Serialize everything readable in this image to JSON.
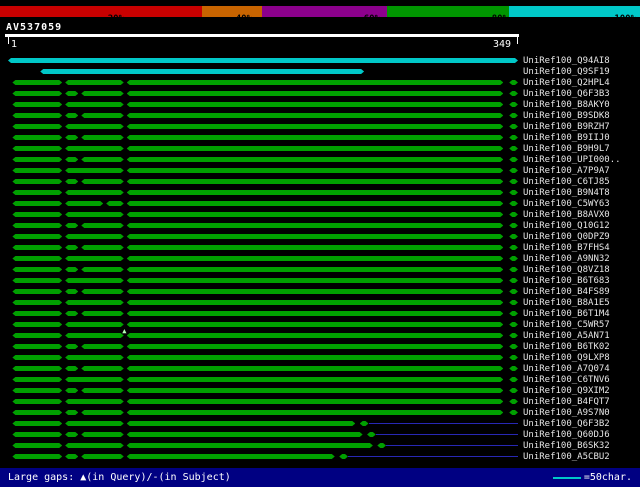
{
  "scale_bar": {
    "labels": [
      "20%",
      "~40%",
      "~60%",
      "~80%",
      "~100%"
    ],
    "segments": [
      {
        "color": "#c80000",
        "width_pct": 31.5
      },
      {
        "color": "#c86400",
        "width_pct": 9.5
      },
      {
        "color": "#8c008c",
        "width_pct": 19.5
      },
      {
        "color": "#009600",
        "width_pct": 19.0
      },
      {
        "color": "#00c8c8",
        "width_pct": 20.5
      }
    ]
  },
  "query": {
    "name": "AV537059",
    "start": "1",
    "end": "349"
  },
  "legend": {
    "gaps_text": "Large gaps: ▲(in Query)/-(in Subject)",
    "unit_text": "=50char."
  },
  "colors": {
    "hit_green": "#00a000",
    "hit_cyan": "#00c8c8",
    "tail_blue": "#2828b4",
    "legend_bg": "#000082",
    "marker_green": "#b4ffb4"
  },
  "chart_data": {
    "type": "bar",
    "orientation": "horizontal",
    "title": "AV537059",
    "axis": {
      "min": 1,
      "max": 349,
      "start_label": "1",
      "end_label": "349"
    },
    "identity_scale_labels": [
      "20%",
      "~40%",
      "~60%",
      "~80%",
      "~100%"
    ],
    "rows": [
      {
        "label": "UniRef100_Q94AI8",
        "color": "cyan",
        "segments": [
          [
            1,
            349
          ]
        ]
      },
      {
        "label": "UniRef100_Q9SF19",
        "color": "cyan",
        "segments": [
          [
            23,
            244
          ]
        ]
      },
      {
        "label": "UniRef100_Q2HPL4",
        "color": "green",
        "segments": [
          [
            4,
            38
          ],
          [
            40,
            80
          ],
          [
            82,
            339
          ],
          [
            343,
            349
          ]
        ]
      },
      {
        "label": "UniRef100_Q6F3B3",
        "color": "green",
        "segments": [
          [
            4,
            38
          ],
          [
            40,
            49
          ],
          [
            51,
            80
          ],
          [
            82,
            339
          ],
          [
            343,
            349
          ]
        ]
      },
      {
        "label": "UniRef100_B8AKY0",
        "color": "green",
        "segments": [
          [
            4,
            38
          ],
          [
            40,
            80
          ],
          [
            82,
            339
          ],
          [
            343,
            349
          ]
        ]
      },
      {
        "label": "UniRef100_B9SDK8",
        "color": "green",
        "segments": [
          [
            4,
            38
          ],
          [
            40,
            49
          ],
          [
            51,
            80
          ],
          [
            82,
            339
          ],
          [
            343,
            349
          ]
        ]
      },
      {
        "label": "UniRef100_B9RZH7",
        "color": "green",
        "segments": [
          [
            4,
            38
          ],
          [
            40,
            80
          ],
          [
            82,
            339
          ],
          [
            343,
            349
          ]
        ]
      },
      {
        "label": "UniRef100_B9IIJ0",
        "color": "green",
        "segments": [
          [
            4,
            38
          ],
          [
            40,
            49
          ],
          [
            51,
            80
          ],
          [
            82,
            339
          ],
          [
            343,
            349
          ]
        ]
      },
      {
        "label": "UniRef100_B9H9L7",
        "color": "green",
        "segments": [
          [
            4,
            38
          ],
          [
            40,
            80
          ],
          [
            82,
            339
          ],
          [
            343,
            349
          ]
        ]
      },
      {
        "label": "UniRef100_UPI000..",
        "color": "green",
        "segments": [
          [
            4,
            38
          ],
          [
            40,
            49
          ],
          [
            51,
            80
          ],
          [
            82,
            339
          ],
          [
            343,
            349
          ]
        ]
      },
      {
        "label": "UniRef100_A7P9A7",
        "color": "green",
        "segments": [
          [
            4,
            38
          ],
          [
            40,
            80
          ],
          [
            82,
            339
          ],
          [
            343,
            349
          ]
        ]
      },
      {
        "label": "UniRef100_C6TJ85",
        "color": "green",
        "segments": [
          [
            4,
            38
          ],
          [
            40,
            49
          ],
          [
            51,
            80
          ],
          [
            82,
            339
          ],
          [
            343,
            349
          ]
        ]
      },
      {
        "label": "UniRef100_B9N4T8",
        "color": "green",
        "segments": [
          [
            4,
            38
          ],
          [
            40,
            80
          ],
          [
            82,
            339
          ],
          [
            343,
            349
          ]
        ]
      },
      {
        "label": "UniRef100_C5WY63",
        "color": "green",
        "segments": [
          [
            4,
            38
          ],
          [
            40,
            66
          ],
          [
            68,
            80
          ],
          [
            82,
            339
          ],
          [
            343,
            349
          ]
        ]
      },
      {
        "label": "UniRef100_B8AVX0",
        "color": "green",
        "segments": [
          [
            4,
            38
          ],
          [
            40,
            80
          ],
          [
            82,
            339
          ],
          [
            343,
            349
          ]
        ]
      },
      {
        "label": "UniRef100_Q10G12",
        "color": "green",
        "segments": [
          [
            4,
            38
          ],
          [
            40,
            49
          ],
          [
            51,
            80
          ],
          [
            82,
            339
          ],
          [
            343,
            349
          ]
        ]
      },
      {
        "label": "UniRef100_Q0DPZ9",
        "color": "green",
        "segments": [
          [
            4,
            38
          ],
          [
            40,
            80
          ],
          [
            82,
            339
          ],
          [
            343,
            349
          ]
        ]
      },
      {
        "label": "UniRef100_B7FHS4",
        "color": "green",
        "segments": [
          [
            4,
            38
          ],
          [
            40,
            49
          ],
          [
            51,
            80
          ],
          [
            82,
            339
          ],
          [
            343,
            349
          ]
        ]
      },
      {
        "label": "UniRef100_A9NN32",
        "color": "green",
        "segments": [
          [
            4,
            38
          ],
          [
            40,
            80
          ],
          [
            82,
            339
          ],
          [
            343,
            349
          ]
        ]
      },
      {
        "label": "UniRef100_Q8VZ18",
        "color": "green",
        "segments": [
          [
            4,
            38
          ],
          [
            40,
            49
          ],
          [
            51,
            80
          ],
          [
            82,
            339
          ],
          [
            343,
            349
          ]
        ]
      },
      {
        "label": "UniRef100_B6T683",
        "color": "green",
        "segments": [
          [
            4,
            38
          ],
          [
            40,
            80
          ],
          [
            82,
            339
          ],
          [
            343,
            349
          ]
        ]
      },
      {
        "label": "UniRef100_B4FS89",
        "color": "green",
        "segments": [
          [
            4,
            38
          ],
          [
            40,
            49
          ],
          [
            51,
            80
          ],
          [
            82,
            339
          ],
          [
            343,
            349
          ]
        ]
      },
      {
        "label": "UniRef100_B8A1E5",
        "color": "green",
        "segments": [
          [
            4,
            38
          ],
          [
            40,
            80
          ],
          [
            82,
            339
          ],
          [
            343,
            349
          ]
        ]
      },
      {
        "label": "UniRef100_B6T1M4",
        "color": "green",
        "segments": [
          [
            4,
            38
          ],
          [
            40,
            49
          ],
          [
            51,
            80
          ],
          [
            82,
            339
          ],
          [
            343,
            349
          ]
        ]
      },
      {
        "label": "UniRef100_C5WR57",
        "color": "green",
        "segments": [
          [
            4,
            38
          ],
          [
            40,
            80
          ],
          [
            82,
            339
          ],
          [
            343,
            349
          ]
        ]
      },
      {
        "label": "UniRef100_A5AN71",
        "color": "green",
        "segments": [
          [
            4,
            38
          ],
          [
            40,
            80
          ],
          [
            82,
            339
          ],
          [
            343,
            349
          ]
        ],
        "marker": {
          "symbol": "▲",
          "pos": 81
        }
      },
      {
        "label": "UniRef100_B6TK02",
        "color": "green",
        "segments": [
          [
            4,
            38
          ],
          [
            40,
            49
          ],
          [
            51,
            80
          ],
          [
            82,
            339
          ],
          [
            343,
            349
          ]
        ]
      },
      {
        "label": "UniRef100_Q9LXP8",
        "color": "green",
        "segments": [
          [
            4,
            38
          ],
          [
            40,
            80
          ],
          [
            82,
            339
          ],
          [
            343,
            349
          ]
        ]
      },
      {
        "label": "UniRef100_A7Q074",
        "color": "green",
        "segments": [
          [
            4,
            38
          ],
          [
            40,
            49
          ],
          [
            51,
            80
          ],
          [
            82,
            339
          ],
          [
            343,
            349
          ]
        ]
      },
      {
        "label": "UniRef100_C6TNV6",
        "color": "green",
        "segments": [
          [
            4,
            38
          ],
          [
            40,
            80
          ],
          [
            82,
            339
          ],
          [
            343,
            349
          ]
        ]
      },
      {
        "label": "UniRef100_Q9XIM2",
        "color": "green",
        "segments": [
          [
            4,
            38
          ],
          [
            40,
            49
          ],
          [
            51,
            80
          ],
          [
            82,
            339
          ],
          [
            343,
            349
          ]
        ]
      },
      {
        "label": "UniRef100_B4FQT7",
        "color": "green",
        "segments": [
          [
            4,
            38
          ],
          [
            40,
            80
          ],
          [
            82,
            339
          ],
          [
            343,
            349
          ]
        ]
      },
      {
        "label": "UniRef100_A9S7N0",
        "color": "green",
        "segments": [
          [
            4,
            38
          ],
          [
            40,
            49
          ],
          [
            51,
            80
          ],
          [
            82,
            339
          ],
          [
            343,
            349
          ]
        ]
      },
      {
        "label": "UniRef100_Q6F3B2",
        "color": "green",
        "segments": [
          [
            4,
            38
          ],
          [
            40,
            80
          ],
          [
            82,
            238
          ],
          [
            241,
            247
          ]
        ],
        "tail": [
          247,
          349
        ]
      },
      {
        "label": "UniRef100_Q60DJ6",
        "color": "green",
        "segments": [
          [
            4,
            38
          ],
          [
            40,
            49
          ],
          [
            51,
            80
          ],
          [
            82,
            243
          ],
          [
            246,
            252
          ]
        ],
        "tail": [
          252,
          349
        ]
      },
      {
        "label": "UniRef100_B6SK32",
        "color": "green",
        "segments": [
          [
            4,
            38
          ],
          [
            40,
            80
          ],
          [
            82,
            250
          ],
          [
            253,
            259
          ]
        ],
        "tail": [
          259,
          349
        ]
      },
      {
        "label": "UniRef100_A5CBU2",
        "color": "green",
        "segments": [
          [
            4,
            38
          ],
          [
            40,
            49
          ],
          [
            51,
            80
          ],
          [
            82,
            224
          ],
          [
            227,
            233
          ]
        ],
        "tail": [
          233,
          349
        ]
      }
    ]
  }
}
